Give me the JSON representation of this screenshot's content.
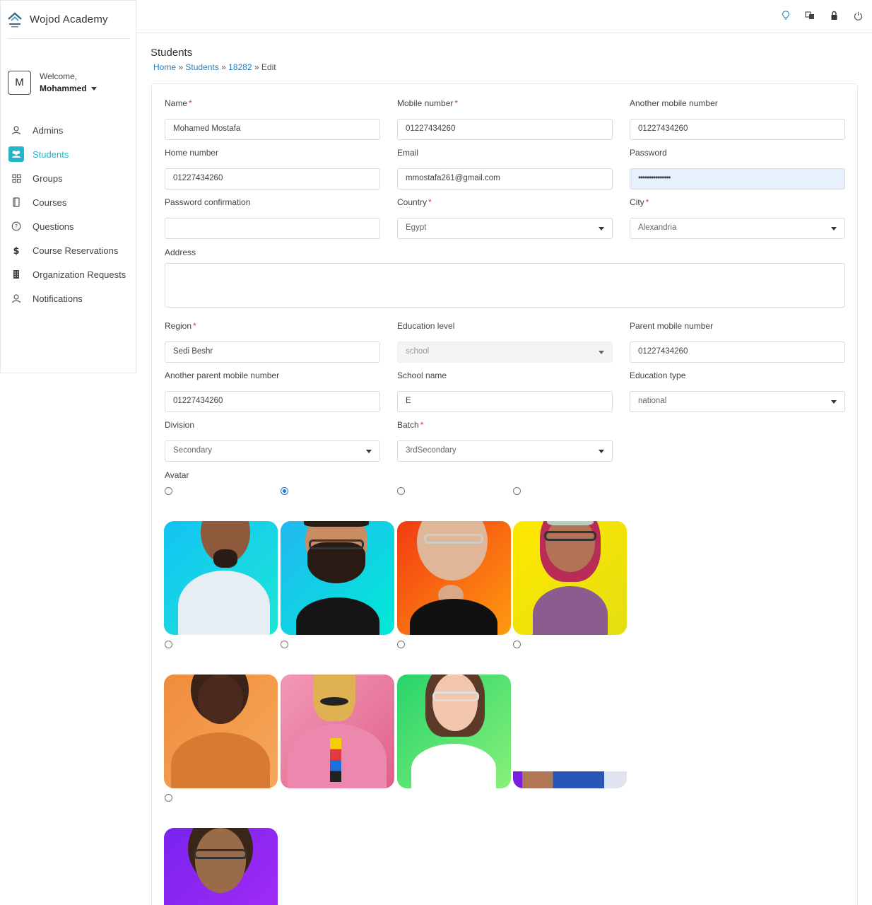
{
  "brand": {
    "name": "Wojod Academy",
    "logo_icon": "wojod-logo-icon"
  },
  "user": {
    "initial": "M",
    "welcome": "Welcome,",
    "name": "Mohammed"
  },
  "sidebar": {
    "items": [
      {
        "label": "Admins",
        "icon": "admin-user-icon"
      },
      {
        "label": "Students",
        "icon": "users-icon",
        "active": true
      },
      {
        "label": "Groups",
        "icon": "grid-icon"
      },
      {
        "label": "Courses",
        "icon": "book-icon"
      },
      {
        "label": "Questions",
        "icon": "question-circle-icon"
      },
      {
        "label": "Course Reservations",
        "icon": "dollar-icon"
      },
      {
        "label": "Organization Requests",
        "icon": "building-icon"
      },
      {
        "label": "Notifications",
        "icon": "bell-user-icon"
      }
    ]
  },
  "topbar": {
    "icons": [
      "lightbulb-icon",
      "translate-icon",
      "lock-icon",
      "power-icon"
    ]
  },
  "page": {
    "title": "Students",
    "breadcrumb": {
      "home": "Home",
      "sep1": "»",
      "students": "Students",
      "sep2": "»",
      "id": "18282",
      "sep3": "»",
      "current": "Edit"
    }
  },
  "form": {
    "name": {
      "label": "Name",
      "value": "Mohamed Mostafa",
      "required": "*"
    },
    "mobile": {
      "label": "Mobile number",
      "value": "01227434260",
      "required": "*"
    },
    "another_mobile": {
      "label": "Another mobile number",
      "value": "01227434260"
    },
    "home_number": {
      "label": "Home number",
      "value": "01227434260"
    },
    "email": {
      "label": "Email",
      "value": "mmostafa261@gmail.com"
    },
    "password": {
      "label": "Password",
      "value": "•••••••••••••••"
    },
    "password_confirmation": {
      "label": "Password confirmation",
      "value": ""
    },
    "country": {
      "label": "Country",
      "value": "Egypt",
      "required": "*"
    },
    "city": {
      "label": "City",
      "value": "Alexandria",
      "required": "*"
    },
    "address": {
      "label": "Address",
      "value": ""
    },
    "region": {
      "label": "Region",
      "value": "Sedi Beshr",
      "required": "*"
    },
    "education_level": {
      "label": "Education level",
      "value": "school"
    },
    "parent_mobile": {
      "label": "Parent mobile number",
      "value": "01227434260"
    },
    "another_parent_mobile": {
      "label": "Another parent mobile number",
      "value": "01227434260"
    },
    "school_name": {
      "label": "School name",
      "value": "E"
    },
    "education_type": {
      "label": "Education type",
      "value": "national"
    },
    "division": {
      "label": "Division",
      "value": "Secondary"
    },
    "batch": {
      "label": "Batch",
      "value": "3rdSecondary",
      "required": "*"
    },
    "avatar": {
      "label": "Avatar",
      "selected_index": 1
    }
  },
  "colors": {
    "accent": "#26b5c8",
    "link": "#2a7fb8",
    "required": "#dc3545",
    "radio_checked": "#1a73e8"
  }
}
